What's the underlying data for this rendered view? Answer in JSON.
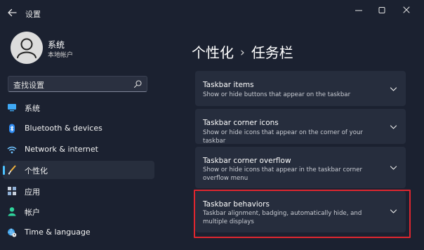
{
  "window": {
    "title": "设置"
  },
  "user": {
    "name": "系统",
    "account_type": "本地帐户"
  },
  "search": {
    "text": "查找设置"
  },
  "sidebar": {
    "items": [
      {
        "label": "系统",
        "icon": "monitor-icon",
        "active": false
      },
      {
        "label": "Bluetooth & devices",
        "icon": "bluetooth-icon",
        "active": false
      },
      {
        "label": "Network & internet",
        "icon": "wifi-icon",
        "active": false
      },
      {
        "label": "个性化",
        "icon": "brush-icon",
        "active": true
      },
      {
        "label": "应用",
        "icon": "apps-icon",
        "active": false
      },
      {
        "label": "帐户",
        "icon": "person-icon",
        "active": false
      },
      {
        "label": "Time & language",
        "icon": "globe-clock-icon",
        "active": false
      }
    ]
  },
  "breadcrumb": {
    "parent": "个性化",
    "separator": "›",
    "current": "任务栏"
  },
  "cards": [
    {
      "title": "Taskbar items",
      "description": "Show or hide buttons that appear on the taskbar"
    },
    {
      "title": "Taskbar corner icons",
      "description": "Show or hide icons that appear on the corner of your taskbar"
    },
    {
      "title": "Taskbar corner overflow",
      "description": "Show or hide icons that appear in the taskbar corner overflow menu"
    },
    {
      "title": "Taskbar behaviors",
      "description": "Taskbar alignment, badging, automatically hide, and multiple displays",
      "highlighted": true
    }
  ],
  "colors": {
    "background": "#1b2130",
    "card": "#262d3d",
    "accent": "#4cc2ff",
    "highlight_border": "#e0262f"
  }
}
